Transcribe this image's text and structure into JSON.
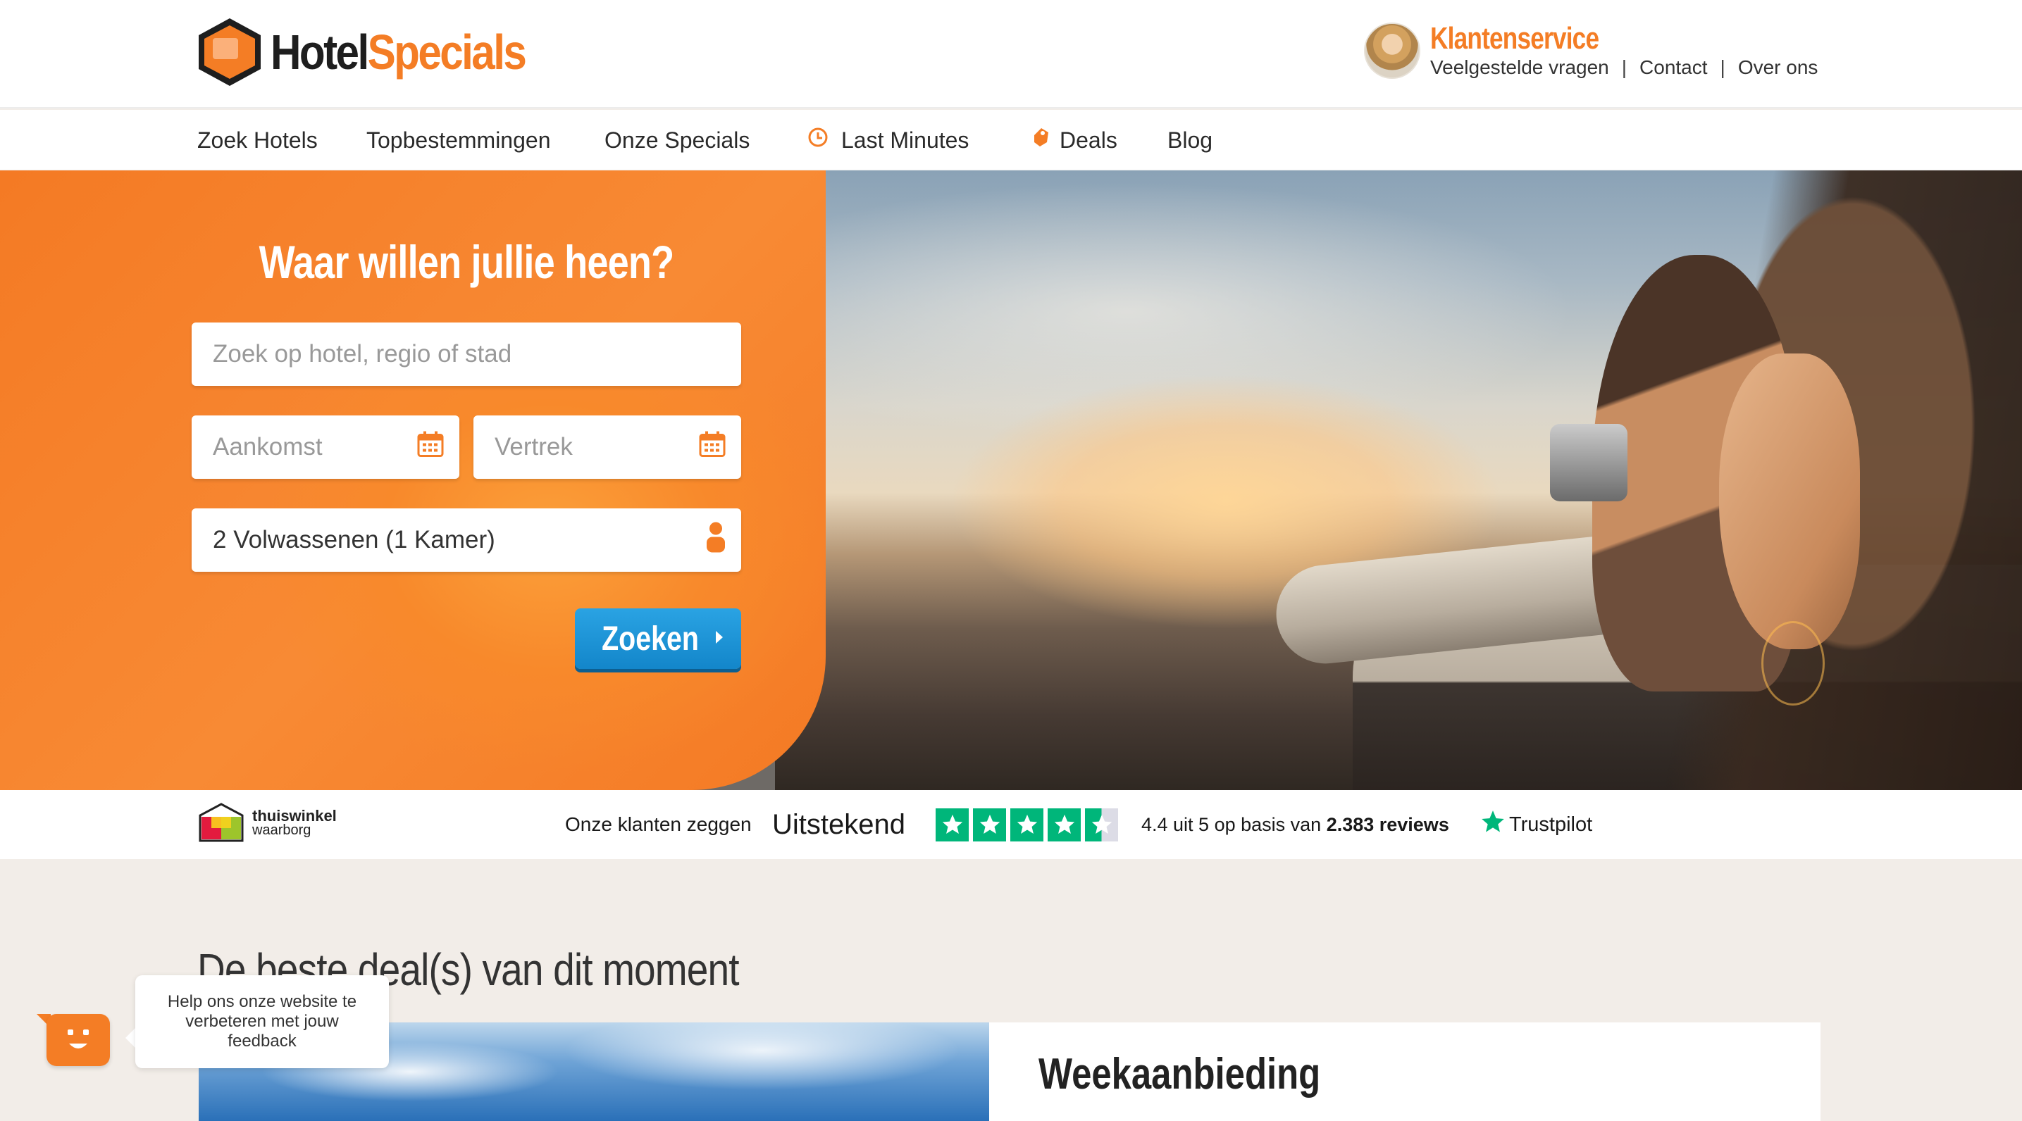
{
  "header": {
    "logo": {
      "part1": "Hotel",
      "part2": "Specials"
    },
    "customer_service": {
      "title": "Klantenservice",
      "links": [
        "Veelgestelde vragen",
        "Contact",
        "Over ons"
      ]
    }
  },
  "nav": {
    "items": [
      {
        "label": "Zoek Hotels",
        "icon": ""
      },
      {
        "label": "Topbestemmingen",
        "icon": ""
      },
      {
        "label": "Onze Specials",
        "icon": ""
      },
      {
        "label": "Last Minutes",
        "icon": "clock-icon"
      },
      {
        "label": "Deals",
        "icon": "tag-icon"
      },
      {
        "label": "Blog",
        "icon": ""
      }
    ]
  },
  "search": {
    "title": "Waar willen jullie heen?",
    "destination_placeholder": "Zoek op hotel, regio of stad",
    "arrival_placeholder": "Aankomst",
    "departure_placeholder": "Vertrek",
    "guests_value": "2 Volwassenen (1 Kamer)",
    "button_label": "Zoeken"
  },
  "trust": {
    "thuiswinkel": {
      "line1": "thuiswinkel",
      "line2": "waarborg"
    },
    "intro": "Onze klanten zeggen",
    "rating_word": "Uitstekend",
    "stars": 4.5,
    "score_text_prefix": "4.4 uit 5 op basis van ",
    "review_count": "2.383 reviews",
    "brand": "Trustpilot"
  },
  "deals": {
    "section_title": "De beste deal(s) van dit moment",
    "card_title": "Weekaanbieding"
  },
  "feedback": {
    "text": "Help ons onze website te verbeteren met jouw feedback"
  },
  "colors": {
    "brand_orange": "#f47d25",
    "button_blue": "#1b95d8",
    "trustpilot_green": "#00b67a"
  }
}
